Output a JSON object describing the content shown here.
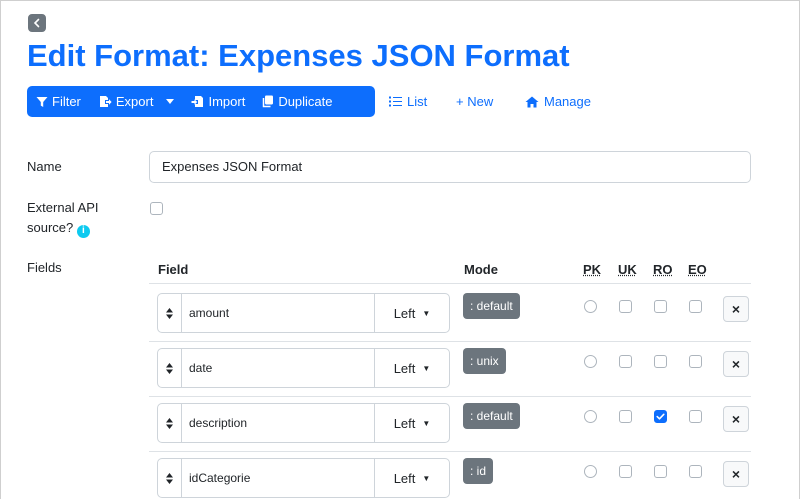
{
  "header": {
    "back_icon": "chevron-left-icon",
    "title": "Edit Format: Expenses JSON Format"
  },
  "toolbar": {
    "filter_label": "Filter",
    "export_label": "Export",
    "import_label": "Import",
    "duplicate_label": "Duplicate",
    "list_label": "List",
    "new_label": "+ New",
    "manage_label": "Manage",
    "accent_color": "#0d6efd"
  },
  "form": {
    "name_label": "Name",
    "name_value": "Expenses JSON Format",
    "external_label_line1": "External API",
    "external_label_line2": "source?",
    "external_checked": false,
    "fields_label": "Fields"
  },
  "fields_table": {
    "headers": {
      "field": "Field",
      "mode": "Mode",
      "pk": "PK",
      "uk": "UK",
      "ro": "RO",
      "eo": "EO"
    },
    "rows": [
      {
        "name": "amount",
        "align": "Left",
        "mode": ": default",
        "pk": false,
        "uk": false,
        "ro": false,
        "eo": false,
        "delete": "×"
      },
      {
        "name": "date",
        "align": "Left",
        "mode": ": unix",
        "pk": false,
        "uk": false,
        "ro": false,
        "eo": false,
        "delete": "×"
      },
      {
        "name": "description",
        "align": "Left",
        "mode": ": default",
        "pk": false,
        "uk": false,
        "ro": true,
        "eo": false,
        "delete": "×"
      },
      {
        "name": "idCategorie",
        "align": "Left",
        "mode": ": id",
        "pk": false,
        "uk": false,
        "ro": false,
        "eo": false,
        "delete": "×"
      }
    ]
  }
}
